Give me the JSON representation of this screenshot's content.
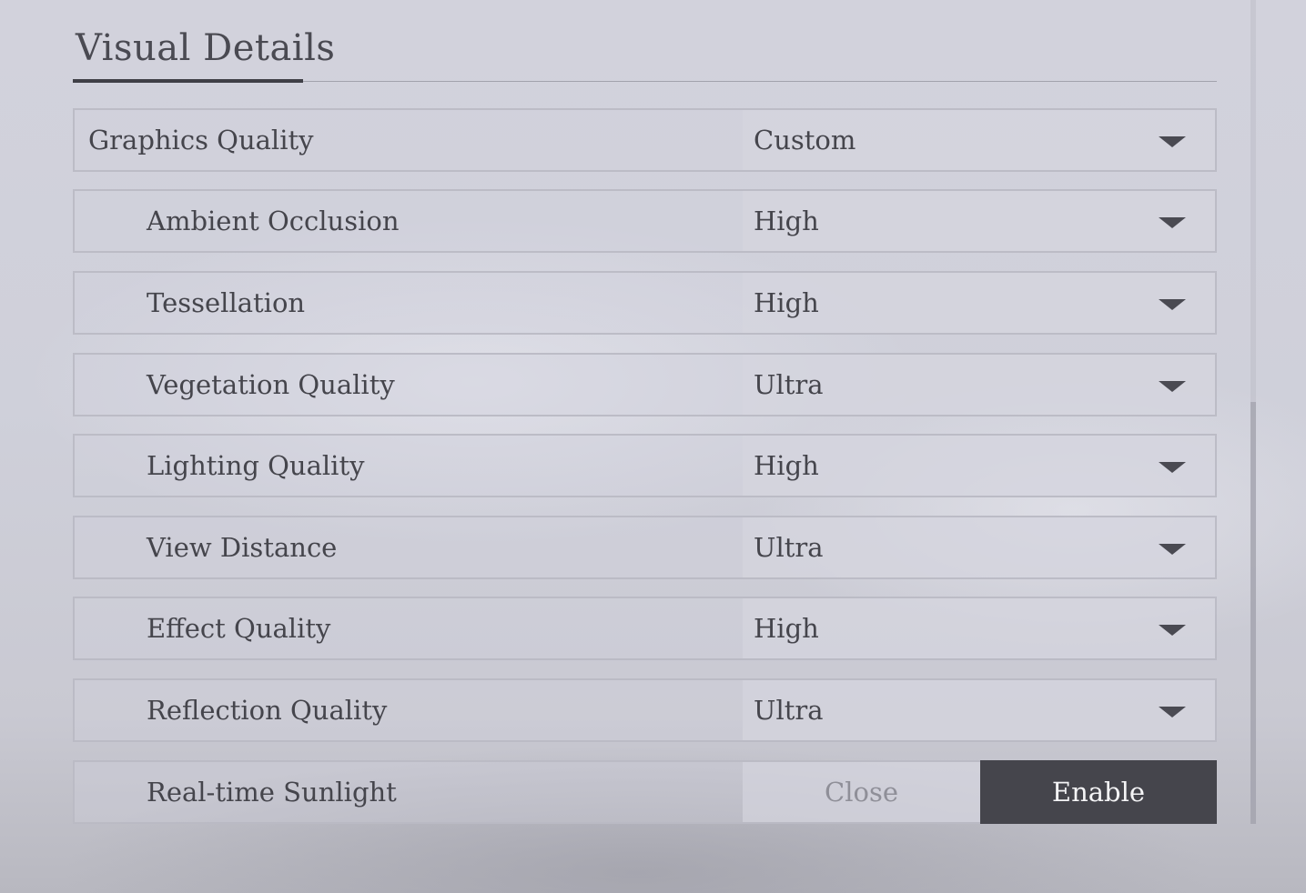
{
  "section": {
    "title": "Visual Details"
  },
  "settings": [
    {
      "label": "Graphics Quality",
      "value": "Custom",
      "level": "top"
    },
    {
      "label": "Ambient Occlusion",
      "value": "High",
      "level": "sub"
    },
    {
      "label": "Tessellation",
      "value": "High",
      "level": "sub"
    },
    {
      "label": "Vegetation Quality",
      "value": "Ultra",
      "level": "sub"
    },
    {
      "label": "Lighting Quality",
      "value": "High",
      "level": "sub"
    },
    {
      "label": "View Distance",
      "value": "Ultra",
      "level": "sub"
    },
    {
      "label": "Effect Quality",
      "value": "High",
      "level": "sub"
    },
    {
      "label": "Reflection Quality",
      "value": "Ultra",
      "level": "sub"
    }
  ],
  "sunlight": {
    "label": "Real-time Sunlight",
    "off_label": "Close",
    "on_label": "Enable",
    "selected": "Enable"
  },
  "colors": {
    "selected_toggle": "#45454c",
    "unselected_toggle_text": "#8f8f98",
    "text": "#45454c"
  },
  "icons": {
    "dropdown": "chevron-down-icon"
  }
}
